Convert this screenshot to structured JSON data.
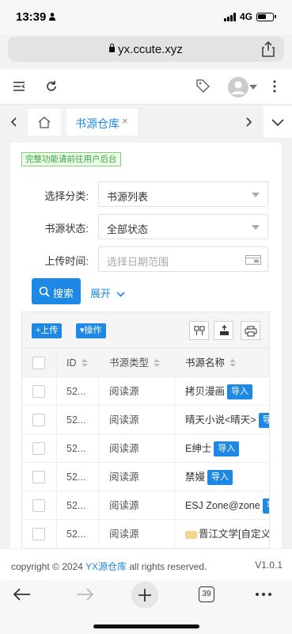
{
  "status": {
    "time": "13:39",
    "network": "4G"
  },
  "browser": {
    "url": "yx.ccute.xyz",
    "tab_count": "39"
  },
  "tabs": {
    "active_label": "书源仓库",
    "close_glyph": "×"
  },
  "notice": "完整功能请前往用户后台",
  "form": {
    "category_label": "选择分类:",
    "category_value": "书源列表",
    "status_label": "书源状态:",
    "status_value": "全部状态",
    "upload_label": "上传时间:",
    "upload_placeholder": "选择日期范围",
    "search_label": "搜索",
    "expand_label": "展开"
  },
  "toolbar": {
    "upload_label": "+上传",
    "ops_label": "▾操作"
  },
  "table": {
    "headers": [
      "ID",
      "书源类型",
      "书源名称"
    ],
    "rows": [
      {
        "id": "52...",
        "type": "阅读源",
        "name": "拷贝漫画",
        "action": "导入"
      },
      {
        "id": "52...",
        "type": "阅读源",
        "name": "晴天小说<晴天>",
        "action": "导入"
      },
      {
        "id": "52...",
        "type": "阅读源",
        "name": "E绅士",
        "action": "导入"
      },
      {
        "id": "52...",
        "type": "阅读源",
        "name": "禁嫚",
        "action": "导入"
      },
      {
        "id": "52...",
        "type": "阅读源",
        "name": "ESJ Zone@zone",
        "action": "导入"
      },
      {
        "id": "52...",
        "type": "阅读源",
        "name": "晋江文学[自定义",
        "action": ""
      }
    ]
  },
  "footer": {
    "prefix": "copyright © 2024 ",
    "brand": "YX源仓库",
    "suffix": " all rights reserved.",
    "version": "V1.0.1"
  },
  "colors": {
    "accent": "#1e88e5",
    "notice_green": "#35a843"
  }
}
